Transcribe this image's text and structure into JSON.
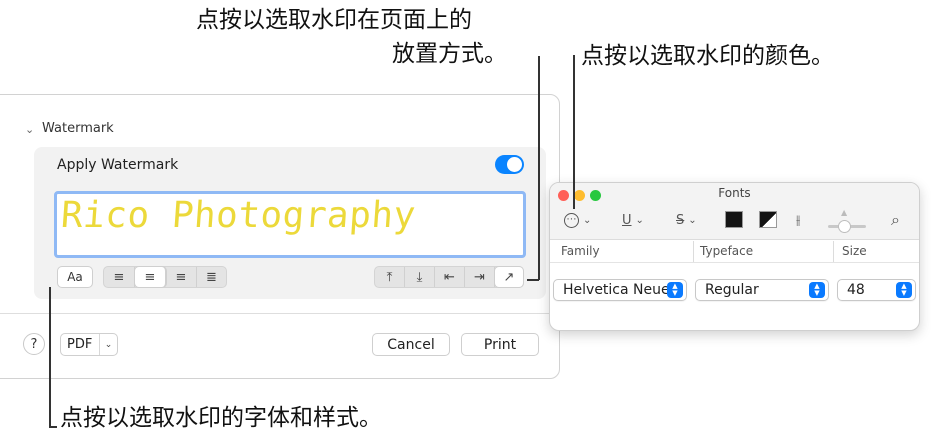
{
  "callouts": {
    "placement_line1": "点按以选取水印在页面上的",
    "placement_line2": "放置方式。",
    "color": "点按以选取水印的颜色。",
    "font": "点按以选取水印的字体和样式。"
  },
  "print_dialog": {
    "section_title": "Watermark",
    "apply_label": "Apply Watermark",
    "apply_enabled": true,
    "watermark_text": "Rico Photography",
    "watermark_color": "#ecd93a",
    "font_button_label": "Aa",
    "align_buttons": [
      {
        "icon": "align-left-icon",
        "glyph": "≡",
        "active": false
      },
      {
        "icon": "align-center-icon",
        "glyph": "≡",
        "active": true
      },
      {
        "icon": "align-right-icon",
        "glyph": "≡",
        "active": false
      },
      {
        "icon": "align-justify-icon",
        "glyph": "≣",
        "active": false
      }
    ],
    "position_buttons": [
      {
        "icon": "align-top-icon",
        "glyph": "⤒"
      },
      {
        "icon": "align-bottom-icon",
        "glyph": "⤓"
      },
      {
        "icon": "align-start-icon",
        "glyph": "⇤"
      },
      {
        "icon": "align-end-icon",
        "glyph": "⇥"
      },
      {
        "icon": "diagonal-arrow-icon",
        "glyph": "↗"
      }
    ],
    "help_label": "?",
    "pdf_label": "PDF",
    "cancel_label": "Cancel",
    "print_label": "Print"
  },
  "fonts_panel": {
    "title": "Fonts",
    "toolbar": {
      "effects_glyph": "⋯",
      "underline_glyph": "U",
      "strikethrough_glyph": "S",
      "text_color": "#141414",
      "document_color": "#141414",
      "spacing_glyph": "⫲",
      "search_glyph": "⌕"
    },
    "columns": {
      "family": "Family",
      "typeface": "Typeface",
      "size": "Size"
    },
    "family_value": "Helvetica Neue",
    "typeface_value": "Regular",
    "size_value": "48"
  },
  "colors": {
    "accent": "#0a84ff",
    "close": "#ff5f57",
    "minimize": "#febc2e",
    "zoom": "#28c840"
  }
}
